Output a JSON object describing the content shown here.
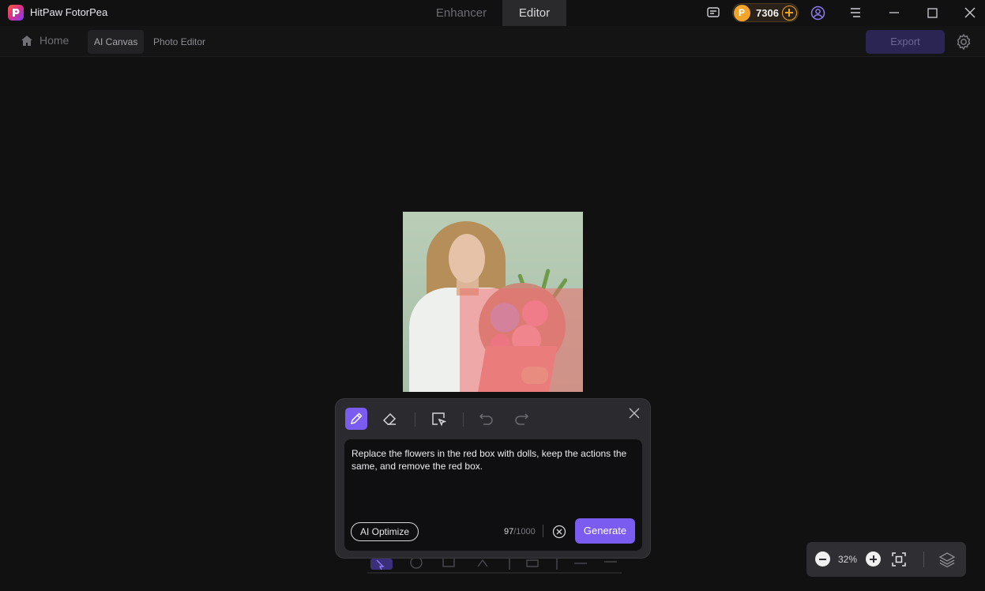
{
  "app": {
    "title": "HitPaw FotorPea"
  },
  "mode_tabs": [
    {
      "label": "Enhancer",
      "active": false
    },
    {
      "label": "Editor",
      "active": true
    }
  ],
  "coins": {
    "count": "7306",
    "symbol": "P",
    "color": "#f2a52a"
  },
  "toolbar": {
    "home_label": "Home",
    "tabs": [
      {
        "label": "AI Canvas",
        "active": true
      },
      {
        "label": "Photo Editor",
        "active": false
      }
    ],
    "export_label": "Export"
  },
  "prompt_panel": {
    "tools": [
      "brush-icon",
      "eraser-icon",
      "select-icon",
      "undo-icon",
      "redo-icon"
    ],
    "prompt_text": "Replace the flowers in the red box with dolls, keep the actions the same, and remove the red box.",
    "ai_optimize_label": "AI Optimize",
    "char_count": "97",
    "char_max": "/1000",
    "generate_label": "Generate"
  },
  "zoom": {
    "value": "32%"
  },
  "colors": {
    "accent": "#7b5cf0",
    "coin": "#f2a52a",
    "background": "#111112"
  }
}
